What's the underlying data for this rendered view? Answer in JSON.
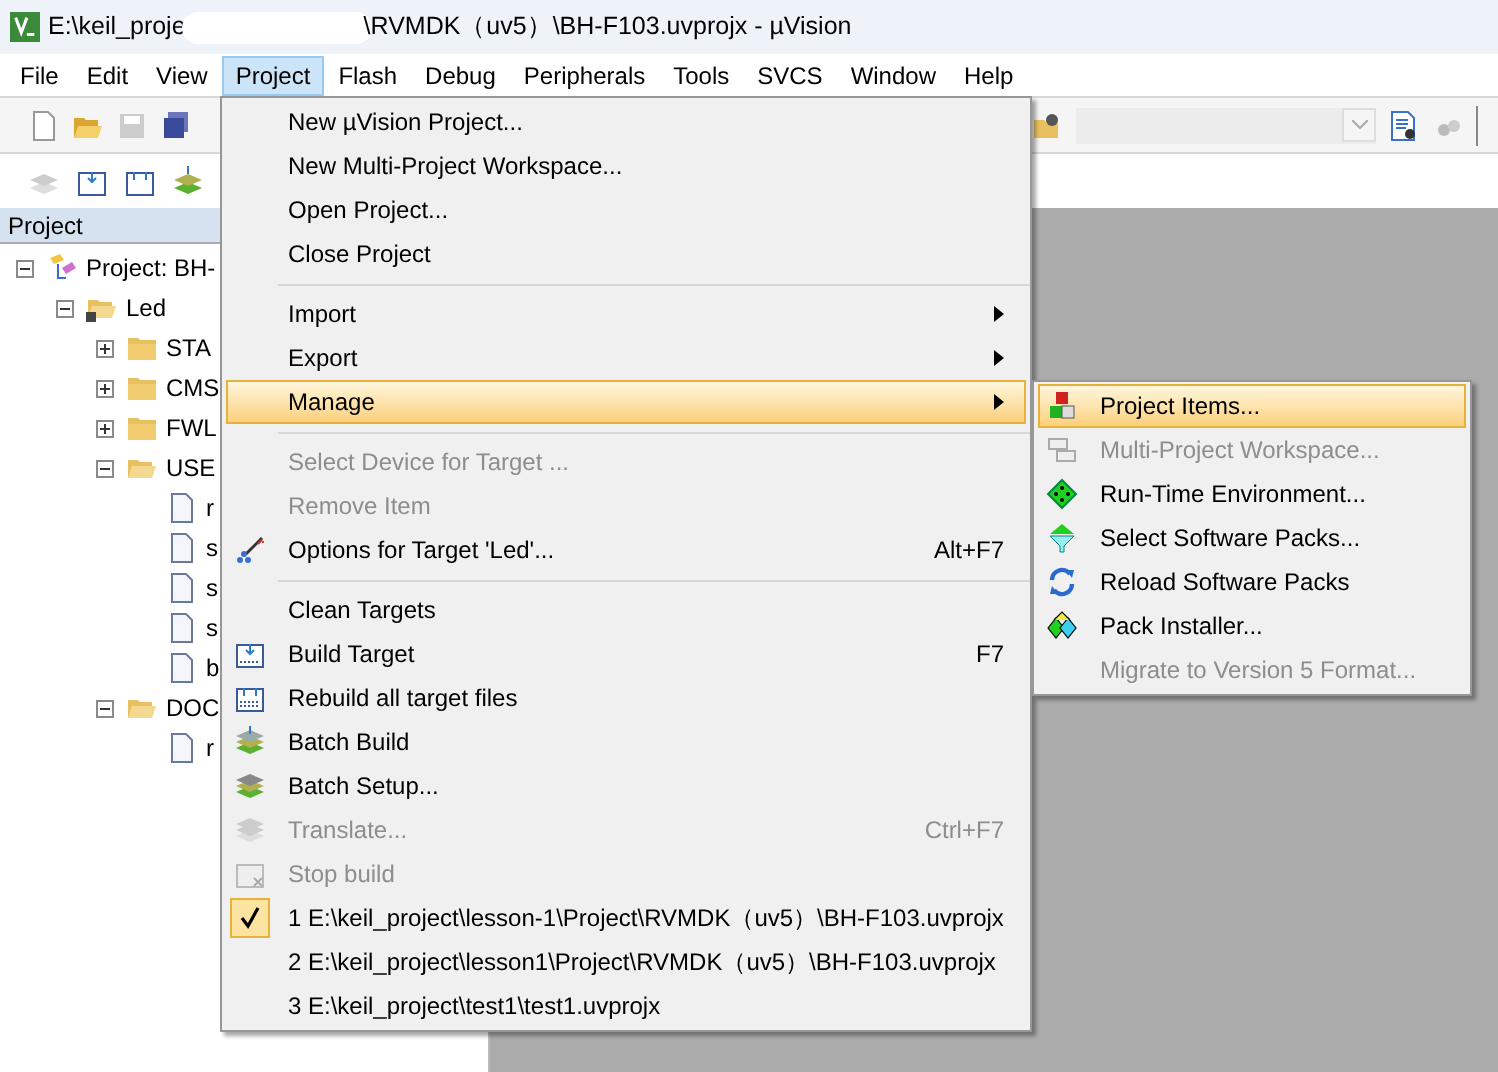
{
  "window": {
    "title_parts": [
      "E:\\keil_proje",
      "\\RVMDK（uv5）\\BH-F103.uvprojx - µVision"
    ]
  },
  "menubar": [
    {
      "label": "File",
      "selected": false
    },
    {
      "label": "Edit",
      "selected": false
    },
    {
      "label": "View",
      "selected": false
    },
    {
      "label": "Project",
      "selected": true
    },
    {
      "label": "Flash",
      "selected": false
    },
    {
      "label": "Debug",
      "selected": false
    },
    {
      "label": "Peripherals",
      "selected": false
    },
    {
      "label": "Tools",
      "selected": false
    },
    {
      "label": "SVCS",
      "selected": false
    },
    {
      "label": "Window",
      "selected": false
    },
    {
      "label": "Help",
      "selected": false
    }
  ],
  "project_panel": {
    "title": "Project",
    "tree": [
      {
        "label": "Project: BH-",
        "kind": "project",
        "expanded": true,
        "children": [
          {
            "label": "Led",
            "kind": "target",
            "expanded": true,
            "children": [
              {
                "label": "STA",
                "kind": "folder",
                "expanded": false
              },
              {
                "label": "CMS",
                "kind": "folder",
                "expanded": false
              },
              {
                "label": "FWL",
                "kind": "folder",
                "expanded": false
              },
              {
                "label": "USE",
                "kind": "folder",
                "expanded": true,
                "children": [
                  {
                    "label": "r",
                    "kind": "file"
                  },
                  {
                    "label": "s",
                    "kind": "file"
                  },
                  {
                    "label": "s",
                    "kind": "file"
                  },
                  {
                    "label": "s",
                    "kind": "file"
                  },
                  {
                    "label": "b",
                    "kind": "file"
                  }
                ]
              },
              {
                "label": "DOC",
                "kind": "folder",
                "expanded": true,
                "children": [
                  {
                    "label": "r",
                    "kind": "file"
                  }
                ]
              }
            ]
          }
        ]
      }
    ]
  },
  "project_menu": [
    {
      "kind": "item",
      "label": "New µVision Project...",
      "disabled": false,
      "selected": false,
      "checked": false,
      "submenu": false
    },
    {
      "kind": "item",
      "label": "New Multi-Project Workspace...",
      "disabled": false,
      "selected": false,
      "checked": false,
      "submenu": false
    },
    {
      "kind": "item",
      "label": "Open Project...",
      "disabled": false,
      "selected": false,
      "checked": false,
      "submenu": false
    },
    {
      "kind": "item",
      "label": "Close Project",
      "disabled": false,
      "selected": false,
      "checked": false,
      "submenu": false
    },
    {
      "kind": "separator"
    },
    {
      "kind": "item",
      "label": "Import",
      "disabled": false,
      "selected": false,
      "checked": false,
      "submenu": true
    },
    {
      "kind": "item",
      "label": "Export",
      "disabled": false,
      "selected": false,
      "checked": false,
      "submenu": true
    },
    {
      "kind": "item",
      "label": "Manage",
      "disabled": false,
      "selected": true,
      "checked": false,
      "submenu": true
    },
    {
      "kind": "separator"
    },
    {
      "kind": "item",
      "label": "Select Device for Target ...",
      "disabled": true,
      "selected": false,
      "checked": false,
      "submenu": false
    },
    {
      "kind": "item",
      "label": "Remove Item",
      "disabled": true,
      "selected": false,
      "checked": false,
      "submenu": false
    },
    {
      "kind": "item",
      "label": "Options for Target 'Led'...",
      "shortcut": "Alt+F7",
      "disabled": false,
      "selected": false,
      "checked": false,
      "submenu": false
    },
    {
      "kind": "separator"
    },
    {
      "kind": "item",
      "label": "Clean Targets",
      "disabled": false,
      "selected": false,
      "checked": false,
      "submenu": false
    },
    {
      "kind": "item",
      "label": "Build Target",
      "shortcut": "F7",
      "disabled": false,
      "selected": false,
      "checked": false,
      "submenu": false
    },
    {
      "kind": "item",
      "label": "Rebuild all target files",
      "disabled": false,
      "selected": false,
      "checked": false,
      "submenu": false
    },
    {
      "kind": "item",
      "label": "Batch Build",
      "disabled": false,
      "selected": false,
      "checked": false,
      "submenu": false
    },
    {
      "kind": "item",
      "label": "Batch Setup...",
      "disabled": false,
      "selected": false,
      "checked": false,
      "submenu": false
    },
    {
      "kind": "item",
      "label": "Translate...",
      "shortcut": "Ctrl+F7",
      "disabled": true,
      "selected": false,
      "checked": false,
      "submenu": false
    },
    {
      "kind": "item",
      "label": "Stop build",
      "disabled": true,
      "selected": false,
      "checked": false,
      "submenu": false
    },
    {
      "kind": "item",
      "label": "1 E:\\keil_project\\lesson-1\\Project\\RVMDK（uv5）\\BH-F103.uvprojx",
      "disabled": false,
      "selected": false,
      "checked": true,
      "submenu": false
    },
    {
      "kind": "item",
      "label": "2 E:\\keil_project\\lesson1\\Project\\RVMDK（uv5）\\BH-F103.uvprojx",
      "disabled": false,
      "selected": false,
      "checked": false,
      "submenu": false
    },
    {
      "kind": "item",
      "label": "3 E:\\keil_project\\test1\\test1.uvprojx",
      "disabled": false,
      "selected": false,
      "checked": false,
      "submenu": false
    }
  ],
  "manage_submenu": [
    {
      "label": "Project Items...",
      "disabled": false,
      "selected": true
    },
    {
      "label": "Multi-Project Workspace...",
      "disabled": true,
      "selected": false
    },
    {
      "label": "Run-Time Environment...",
      "disabled": false,
      "selected": false
    },
    {
      "label": "Select Software Packs...",
      "disabled": false,
      "selected": false
    },
    {
      "label": "Reload Software Packs",
      "disabled": false,
      "selected": false
    },
    {
      "label": "Pack Installer...",
      "disabled": false,
      "selected": false
    },
    {
      "label": "Migrate to Version 5 Format...",
      "disabled": true,
      "selected": false
    }
  ]
}
